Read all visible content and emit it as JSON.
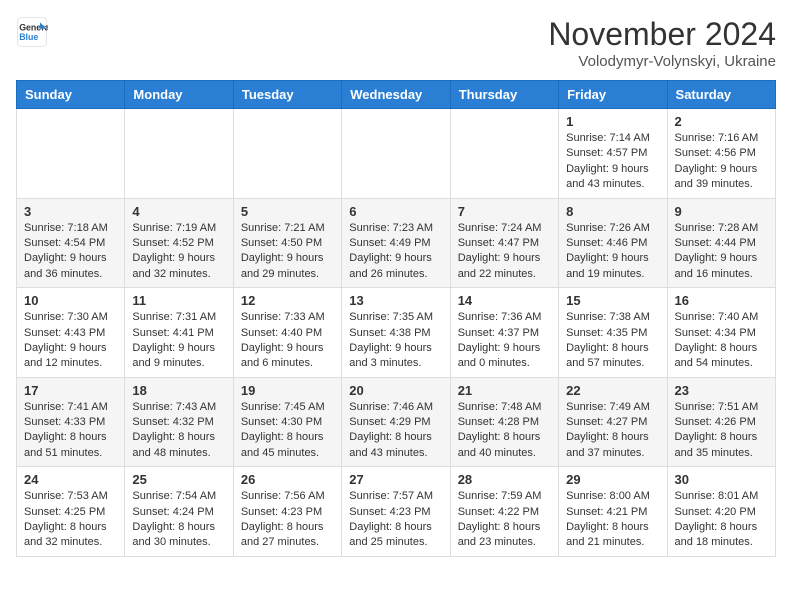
{
  "header": {
    "logo_line1": "General",
    "logo_line2": "Blue",
    "month": "November 2024",
    "location": "Volodymyr-Volynskyi, Ukraine"
  },
  "days_of_week": [
    "Sunday",
    "Monday",
    "Tuesday",
    "Wednesday",
    "Thursday",
    "Friday",
    "Saturday"
  ],
  "weeks": [
    [
      {
        "day": "",
        "info": ""
      },
      {
        "day": "",
        "info": ""
      },
      {
        "day": "",
        "info": ""
      },
      {
        "day": "",
        "info": ""
      },
      {
        "day": "",
        "info": ""
      },
      {
        "day": "1",
        "info": "Sunrise: 7:14 AM\nSunset: 4:57 PM\nDaylight: 9 hours\nand 43 minutes."
      },
      {
        "day": "2",
        "info": "Sunrise: 7:16 AM\nSunset: 4:56 PM\nDaylight: 9 hours\nand 39 minutes."
      }
    ],
    [
      {
        "day": "3",
        "info": "Sunrise: 7:18 AM\nSunset: 4:54 PM\nDaylight: 9 hours\nand 36 minutes."
      },
      {
        "day": "4",
        "info": "Sunrise: 7:19 AM\nSunset: 4:52 PM\nDaylight: 9 hours\nand 32 minutes."
      },
      {
        "day": "5",
        "info": "Sunrise: 7:21 AM\nSunset: 4:50 PM\nDaylight: 9 hours\nand 29 minutes."
      },
      {
        "day": "6",
        "info": "Sunrise: 7:23 AM\nSunset: 4:49 PM\nDaylight: 9 hours\nand 26 minutes."
      },
      {
        "day": "7",
        "info": "Sunrise: 7:24 AM\nSunset: 4:47 PM\nDaylight: 9 hours\nand 22 minutes."
      },
      {
        "day": "8",
        "info": "Sunrise: 7:26 AM\nSunset: 4:46 PM\nDaylight: 9 hours\nand 19 minutes."
      },
      {
        "day": "9",
        "info": "Sunrise: 7:28 AM\nSunset: 4:44 PM\nDaylight: 9 hours\nand 16 minutes."
      }
    ],
    [
      {
        "day": "10",
        "info": "Sunrise: 7:30 AM\nSunset: 4:43 PM\nDaylight: 9 hours\nand 12 minutes."
      },
      {
        "day": "11",
        "info": "Sunrise: 7:31 AM\nSunset: 4:41 PM\nDaylight: 9 hours\nand 9 minutes."
      },
      {
        "day": "12",
        "info": "Sunrise: 7:33 AM\nSunset: 4:40 PM\nDaylight: 9 hours\nand 6 minutes."
      },
      {
        "day": "13",
        "info": "Sunrise: 7:35 AM\nSunset: 4:38 PM\nDaylight: 9 hours\nand 3 minutes."
      },
      {
        "day": "14",
        "info": "Sunrise: 7:36 AM\nSunset: 4:37 PM\nDaylight: 9 hours\nand 0 minutes."
      },
      {
        "day": "15",
        "info": "Sunrise: 7:38 AM\nSunset: 4:35 PM\nDaylight: 8 hours\nand 57 minutes."
      },
      {
        "day": "16",
        "info": "Sunrise: 7:40 AM\nSunset: 4:34 PM\nDaylight: 8 hours\nand 54 minutes."
      }
    ],
    [
      {
        "day": "17",
        "info": "Sunrise: 7:41 AM\nSunset: 4:33 PM\nDaylight: 8 hours\nand 51 minutes."
      },
      {
        "day": "18",
        "info": "Sunrise: 7:43 AM\nSunset: 4:32 PM\nDaylight: 8 hours\nand 48 minutes."
      },
      {
        "day": "19",
        "info": "Sunrise: 7:45 AM\nSunset: 4:30 PM\nDaylight: 8 hours\nand 45 minutes."
      },
      {
        "day": "20",
        "info": "Sunrise: 7:46 AM\nSunset: 4:29 PM\nDaylight: 8 hours\nand 43 minutes."
      },
      {
        "day": "21",
        "info": "Sunrise: 7:48 AM\nSunset: 4:28 PM\nDaylight: 8 hours\nand 40 minutes."
      },
      {
        "day": "22",
        "info": "Sunrise: 7:49 AM\nSunset: 4:27 PM\nDaylight: 8 hours\nand 37 minutes."
      },
      {
        "day": "23",
        "info": "Sunrise: 7:51 AM\nSunset: 4:26 PM\nDaylight: 8 hours\nand 35 minutes."
      }
    ],
    [
      {
        "day": "24",
        "info": "Sunrise: 7:53 AM\nSunset: 4:25 PM\nDaylight: 8 hours\nand 32 minutes."
      },
      {
        "day": "25",
        "info": "Sunrise: 7:54 AM\nSunset: 4:24 PM\nDaylight: 8 hours\nand 30 minutes."
      },
      {
        "day": "26",
        "info": "Sunrise: 7:56 AM\nSunset: 4:23 PM\nDaylight: 8 hours\nand 27 minutes."
      },
      {
        "day": "27",
        "info": "Sunrise: 7:57 AM\nSunset: 4:23 PM\nDaylight: 8 hours\nand 25 minutes."
      },
      {
        "day": "28",
        "info": "Sunrise: 7:59 AM\nSunset: 4:22 PM\nDaylight: 8 hours\nand 23 minutes."
      },
      {
        "day": "29",
        "info": "Sunrise: 8:00 AM\nSunset: 4:21 PM\nDaylight: 8 hours\nand 21 minutes."
      },
      {
        "day": "30",
        "info": "Sunrise: 8:01 AM\nSunset: 4:20 PM\nDaylight: 8 hours\nand 18 minutes."
      }
    ]
  ]
}
